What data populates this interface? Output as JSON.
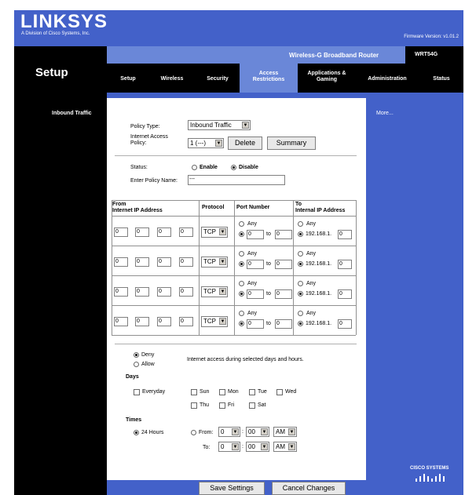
{
  "header": {
    "logo": "LINKSYS",
    "logo_sub": "A Division of Cisco Systems, Inc.",
    "firmware": "Firmware Version: v1.01.2",
    "product": "Wireless-G Broadband Router",
    "model": "WRT54G",
    "section": "Setup"
  },
  "tabs": [
    {
      "label": "Setup"
    },
    {
      "label": "Wireless"
    },
    {
      "label": "Security"
    },
    {
      "label": "Access Restrictions"
    },
    {
      "label": "Applications & Gaming"
    },
    {
      "label": "Administration"
    },
    {
      "label": "Status"
    }
  ],
  "sidebar": {
    "item": "Inbound Traffic",
    "help_link": "More..."
  },
  "form": {
    "policy_type_label": "Policy Type:",
    "policy_type_value": "Inbound Traffic",
    "iap_label_1": "Internet Access",
    "iap_label_2": "Policy:",
    "iap_value": "1 (---)",
    "delete_label": "Delete",
    "summary_label": "Summary",
    "status_label": "Status:",
    "enable_label": "Enable",
    "disable_label": "Disable",
    "policy_name_label": "Enter Policy Name:",
    "policy_name_value": "---"
  },
  "table": {
    "col_from_1": "From",
    "col_from_2": "Internet IP Address",
    "col_protocol": "Protocol",
    "col_port": "Port Number",
    "col_to_1": "To",
    "col_to_2": "Internal IP Address",
    "rows": [
      {
        "ip": [
          "0",
          "0",
          "0",
          "0"
        ],
        "protocol": "TCP",
        "any": "Any",
        "port_from": "0",
        "to": "to",
        "port_to": "0",
        "dest_any": "Any",
        "dest_prefix": "192.168.1.",
        "dest_last": "0"
      },
      {
        "ip": [
          "0",
          "0",
          "0",
          "0"
        ],
        "protocol": "TCP",
        "any": "Any",
        "port_from": "0",
        "to": "to",
        "port_to": "0",
        "dest_any": "Any",
        "dest_prefix": "192.168.1.",
        "dest_last": "0"
      },
      {
        "ip": [
          "0",
          "0",
          "0",
          "0"
        ],
        "protocol": "TCP",
        "any": "Any",
        "port_from": "0",
        "to": "to",
        "port_to": "0",
        "dest_any": "Any",
        "dest_prefix": "192.168.1.",
        "dest_last": "0"
      },
      {
        "ip": [
          "0",
          "0",
          "0",
          "0"
        ],
        "protocol": "TCP",
        "any": "Any",
        "port_from": "0",
        "to": "to",
        "port_to": "0",
        "dest_any": "Any",
        "dest_prefix": "192.168.1.",
        "dest_last": "0"
      }
    ]
  },
  "schedule": {
    "deny_label": "Deny",
    "allow_label": "Allow",
    "access_text": "Internet access during selected days and hours.",
    "days_title": "Days",
    "everyday": "Everyday",
    "sun": "Sun",
    "mon": "Mon",
    "tue": "Tue",
    "wed": "Wed",
    "thu": "Thu",
    "fri": "Fri",
    "sat": "Sat",
    "times_title": "Times",
    "hours24": "24 Hours",
    "from_label": "From:",
    "to_label": "To:",
    "from_hour": "0",
    "from_min": "00",
    "from_ampm": "AM",
    "to_hour": "0",
    "to_min": "00",
    "to_ampm": "AM"
  },
  "footer": {
    "save_label": "Save Settings",
    "cancel_label": "Cancel Changes",
    "brand": "CISCO SYSTEMS"
  },
  "colors": {
    "brand_blue": "#4361c9",
    "light_blue": "#6a87d8",
    "black": "#000000"
  }
}
